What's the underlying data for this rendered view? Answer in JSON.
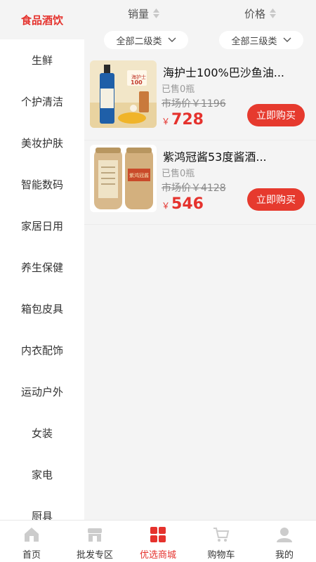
{
  "sidebar": {
    "items": [
      {
        "label": "食品酒饮",
        "active": true
      },
      {
        "label": "生鲜"
      },
      {
        "label": "个护清洁"
      },
      {
        "label": "美妆护肤"
      },
      {
        "label": "智能数码"
      },
      {
        "label": "家居日用"
      },
      {
        "label": "养生保健"
      },
      {
        "label": "箱包皮具"
      },
      {
        "label": "内衣配饰"
      },
      {
        "label": "运动户外"
      },
      {
        "label": "女装"
      },
      {
        "label": "家电"
      },
      {
        "label": "厨具"
      }
    ]
  },
  "sort": {
    "sales_label": "销量",
    "price_label": "价格"
  },
  "filters": {
    "second_label": "全部二级类",
    "third_label": "全部三级类"
  },
  "products": [
    {
      "name": "海护士100%巴沙鱼油...",
      "sold": "已售0瓶",
      "market_price": "市场价￥1196",
      "currency": "￥",
      "price": "728",
      "buy_label": "立即购买",
      "image_icon": "fish-oil-bottle-image",
      "image_text": "海护士",
      "image_badge": "100"
    },
    {
      "name": "紫鸿冠酱53度酱酒...",
      "sold": "已售0瓶",
      "market_price": "市场价￥4128",
      "currency": "￥",
      "price": "546",
      "buy_label": "立即购买",
      "image_icon": "liquor-jars-image",
      "image_text": "紫鸿冠酱"
    }
  ],
  "nav": {
    "items": [
      {
        "label": "首页",
        "icon": "home-icon"
      },
      {
        "label": "批发专区",
        "icon": "store-icon"
      },
      {
        "label": "优选商城",
        "icon": "mall-grid-icon",
        "active": true
      },
      {
        "label": "购物车",
        "icon": "cart-icon"
      },
      {
        "label": "我的",
        "icon": "profile-icon"
      }
    ]
  },
  "colors": {
    "accent": "#e5322d",
    "background": "#f4f4f4"
  }
}
